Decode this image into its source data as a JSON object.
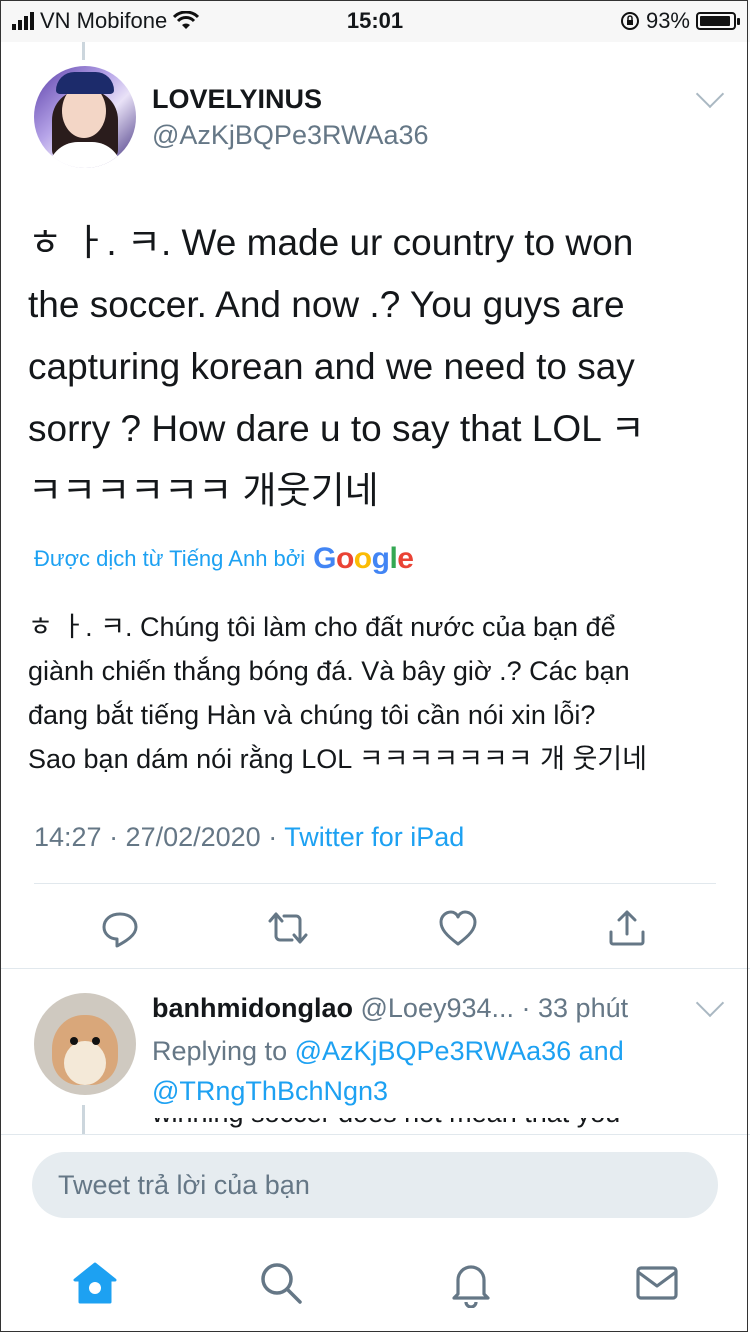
{
  "status_bar": {
    "carrier": "VN Mobifone",
    "time": "15:01",
    "battery": "93%",
    "battery_level": 0.93
  },
  "tweet": {
    "display_name": "LOVELYINUS",
    "handle": "@AzKjBQPe3RWAa36",
    "text": "ㅎ ㅏ. ㅋ. We made ur country to won\nthe soccer. And now .? You guys are\ncapturing korean and we need to say\nsorry ? How dare u to say that LOL ㅋ\nㅋㅋㅋㅋㅋㅋ 개웃기네",
    "translated_label": "Được dịch từ Tiếng Anh bởi",
    "translator": "Google",
    "translation": "ㅎ ㅏ. ㅋ. Chúng tôi làm cho đất nước của bạn để\ngiành chiến thắng bóng đá. Và bây giờ .? Các bạn\nđang bắt tiếng Hàn và chúng tôi cần nói xin lỗi?\nSao bạn dám nói rằng LOL ㅋㅋㅋㅋㅋㅋㅋ 개 웃기네",
    "timestamp": "14:27 · 27/02/2020 ·",
    "via": "Twitter for iPad"
  },
  "actions": [
    {
      "icon": "reply-icon"
    },
    {
      "icon": "retweet-icon"
    },
    {
      "icon": "like-icon"
    },
    {
      "icon": "share-icon"
    }
  ],
  "reply": {
    "display_name": "banhmidonglao",
    "handle": "@Loey934...",
    "time": "· 33 phút",
    "replying_prefix": "Replying to",
    "mention_1": "@AzKjBQPe3RWAa36",
    "conjunction": "and",
    "mention_2": "@TRngThBchNgn3",
    "cut_text": "winning soccer does not mean that you"
  },
  "composer": {
    "placeholder": "Tweet trả lời của bạn"
  },
  "tabs": [
    {
      "icon": "home-icon",
      "active": true
    },
    {
      "icon": "search-icon",
      "active": false
    },
    {
      "icon": "bell-icon",
      "active": false
    },
    {
      "icon": "mail-icon",
      "active": false
    }
  ],
  "colors": {
    "accent": "#1da1f2",
    "secondary_text": "#657786",
    "composer_bg": "#e6ecf0",
    "icon_gray": "#657786"
  }
}
